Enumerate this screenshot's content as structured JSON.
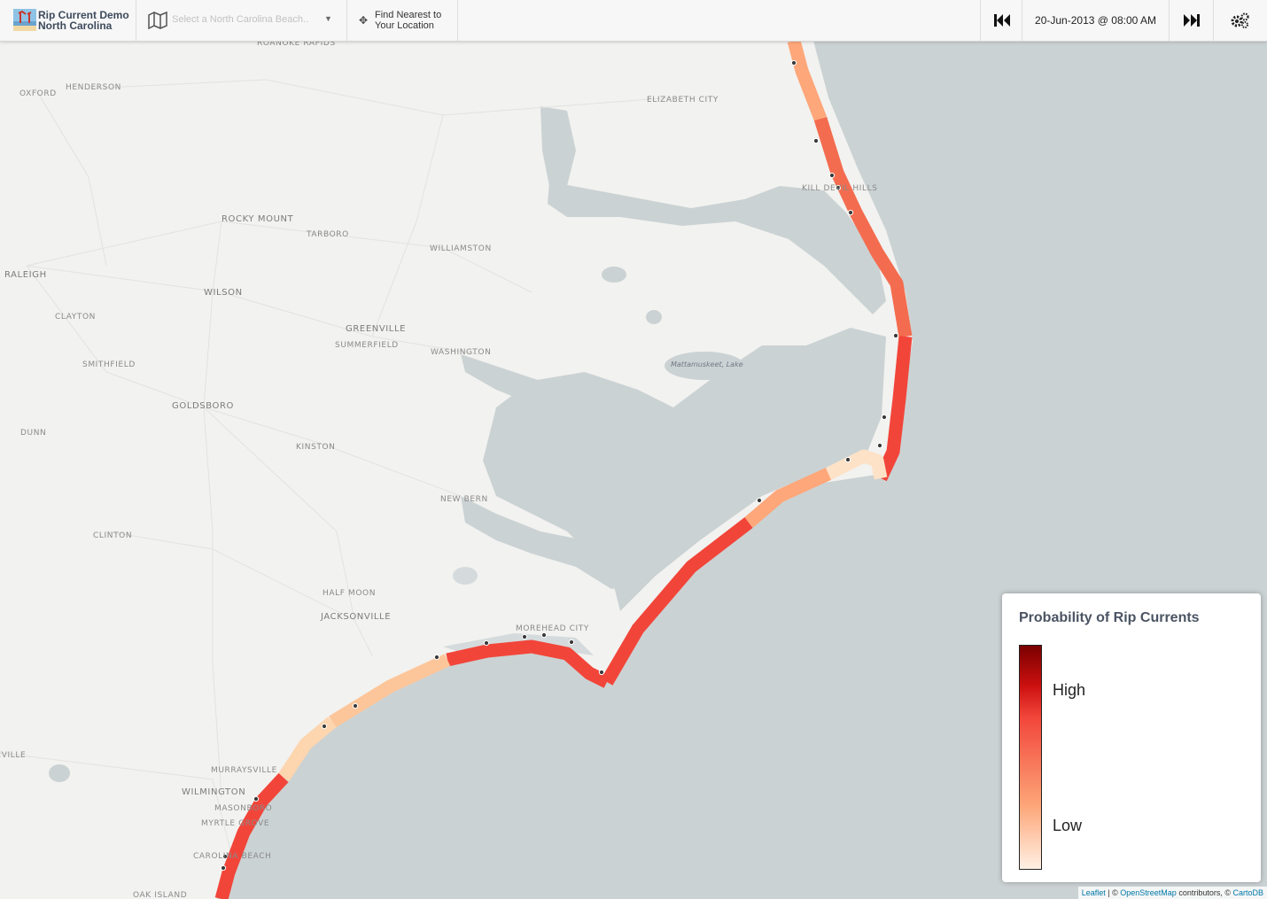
{
  "app": {
    "title_line1": "Rip Current Demo",
    "title_line2": "North Carolina"
  },
  "toolbar": {
    "beach_select_placeholder": "Select a North Carolina Beach..",
    "locate_line1": "Find Nearest to",
    "locate_line2": "Your Location",
    "datetime": "20-Jun-2013 @ 08:00 AM",
    "icons": {
      "logo": "beach-logo-icon",
      "beach_select": "map-icon",
      "caret": "caret-down-icon",
      "locate": "crosshair-icon",
      "prev": "skip-back-icon",
      "next": "skip-forward-icon",
      "settings": "gears-icon"
    }
  },
  "map": {
    "places": [
      "ROANOKE RAPIDS",
      "HENDERSON",
      "OXFORD",
      "ELIZABETH CITY",
      "KILL DEVIL HILLS",
      "ROCKY MOUNT",
      "TARBORO",
      "WILLIAMSTON",
      "RALEIGH",
      "WILSON",
      "CLAYTON",
      "GREENVILLE",
      "SUMMERFIELD",
      "WASHINGTON",
      "SMITHFIELD",
      "GOLDSBORO",
      "DUNN",
      "KINSTON",
      "NEW BERN",
      "CLINTON",
      "HALF MOON",
      "JACKSONVILLE",
      "MOREHEAD CITY",
      "MURRAYSVILLE",
      "WILMINGTON",
      "MASONBORO",
      "MYRTLE GROVE",
      "CAROLINA BEACH",
      "OAK ISLAND",
      "FAYETTEVILLE"
    ],
    "lake_label": "Mattamuskeet, Lake",
    "colors": {
      "land": "#f2f2f0",
      "water": "#cbd2d3",
      "low": "#fde2c8",
      "medium": "#fda77a",
      "high": "#f2453a"
    },
    "segments": [
      {
        "name": "outer-banks-north",
        "level": "medium"
      },
      {
        "name": "outer-banks-central",
        "level": "high"
      },
      {
        "name": "hatteras-south",
        "level": "high"
      },
      {
        "name": "hatteras-island-tip",
        "level": "low"
      },
      {
        "name": "ocracoke",
        "level": "medium"
      },
      {
        "name": "core-banks",
        "level": "high"
      },
      {
        "name": "lookout-bogue",
        "level": "high"
      },
      {
        "name": "topsail",
        "level": "low"
      },
      {
        "name": "topsail-south",
        "level": "low"
      },
      {
        "name": "wrightsville",
        "level": "high"
      }
    ]
  },
  "legend": {
    "title": "Probability of Rip Currents",
    "high_label": "High",
    "low_label": "Low",
    "gradient": [
      "#7a0000",
      "#cc1010",
      "#f2453a",
      "#fda77a",
      "#fff0e4"
    ]
  },
  "attribution": {
    "leaflet": "Leaflet",
    "sep1": " | © ",
    "osm": "OpenStreetMap",
    "contributors": " contributors, © ",
    "carto": "CartoDB"
  }
}
